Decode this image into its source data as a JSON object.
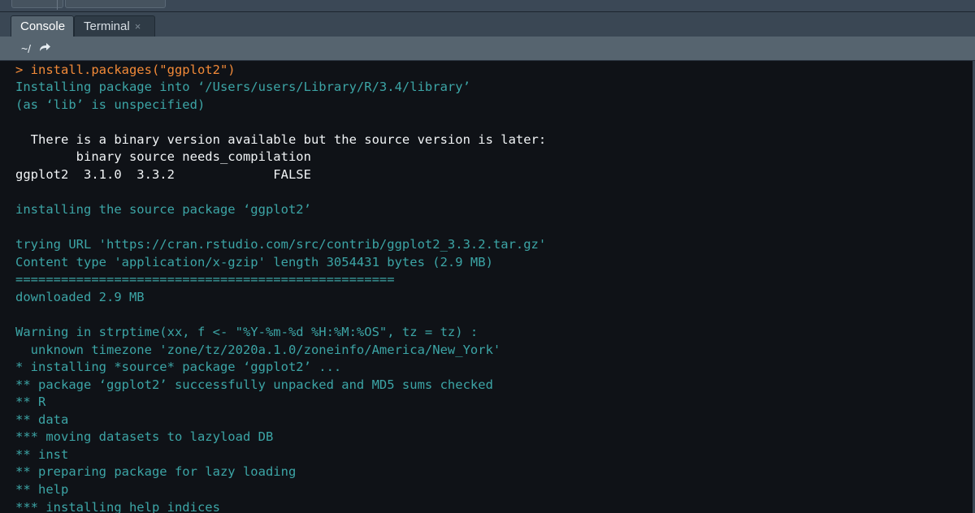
{
  "tabs": {
    "console_label": "Console",
    "terminal_label": "Terminal",
    "terminal_close": "×"
  },
  "pathbar": {
    "path": "~/",
    "goto_icon": "forward-arrow-icon"
  },
  "console": {
    "lines": [
      "> install.packages(\"ggplot2\")",
      "Installing package into ‘/Users/users/Library/R/3.4/library’",
      "(as ‘lib’ is unspecified)",
      "",
      "  There is a binary version available but the source version is later:",
      "        binary source needs_compilation",
      "ggplot2  3.1.0  3.3.2             FALSE",
      "",
      "installing the source package ‘ggplot2’",
      "",
      "trying URL 'https://cran.rstudio.com/src/contrib/ggplot2_3.3.2.tar.gz'",
      "Content type 'application/x-gzip' length 3054431 bytes (2.9 MB)",
      "==================================================",
      "downloaded 2.9 MB",
      "",
      "Warning in strptime(xx, f <- \"%Y-%m-%d %H:%M:%OS\", tz = tz) :",
      "  unknown timezone 'zone/tz/2020a.1.0/zoneinfo/America/New_York'",
      "* installing *source* package ‘ggplot2’ ...",
      "** package ‘ggplot2’ successfully unpacked and MD5 sums checked",
      "** R",
      "** data",
      "*** moving datasets to lazyload DB",
      "** inst",
      "** preparing package for lazy loading",
      "** help",
      "*** installing help indices"
    ]
  },
  "colors": {
    "command": "#f28a38",
    "output": "#3ca5a6",
    "table": "#f1f4f6"
  }
}
